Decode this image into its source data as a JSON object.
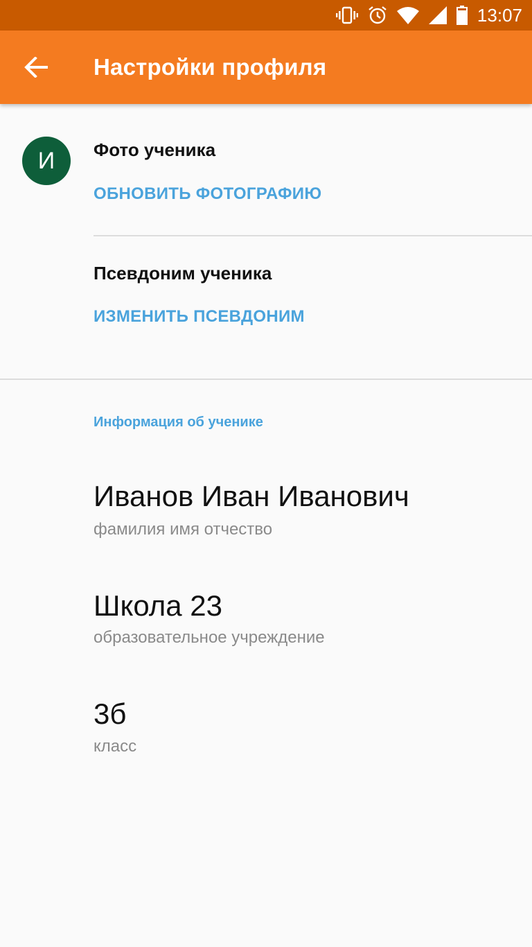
{
  "status_bar": {
    "time": "13:07",
    "icons": [
      "vibrate-icon",
      "alarm-icon",
      "wifi-icon",
      "signal-icon",
      "battery-icon"
    ]
  },
  "app_bar": {
    "title": "Настройки профиля",
    "back_icon": "back-arrow-icon"
  },
  "profile": {
    "avatar_letter": "И",
    "photo_label": "Фото ученика",
    "photo_action": "ОБНОВИТЬ ФОТОГРАФИЮ",
    "nickname_label": "Псевдоним ученика",
    "nickname_action": "ИЗМЕНИТЬ ПСЕВДОНИМ"
  },
  "info": {
    "header": "Информация об ученике",
    "fields": [
      {
        "value": "Иванов Иван Иванович",
        "caption": "фамилия имя отчество"
      },
      {
        "value": "Школа 23",
        "caption": "образовательное учреждение"
      },
      {
        "value": "3б",
        "caption": "класс"
      }
    ]
  },
  "colors": {
    "status_bar": "#c85a00",
    "app_bar": "#f47b20",
    "accent": "#4aa3dc",
    "avatar": "#0e5e3a"
  }
}
